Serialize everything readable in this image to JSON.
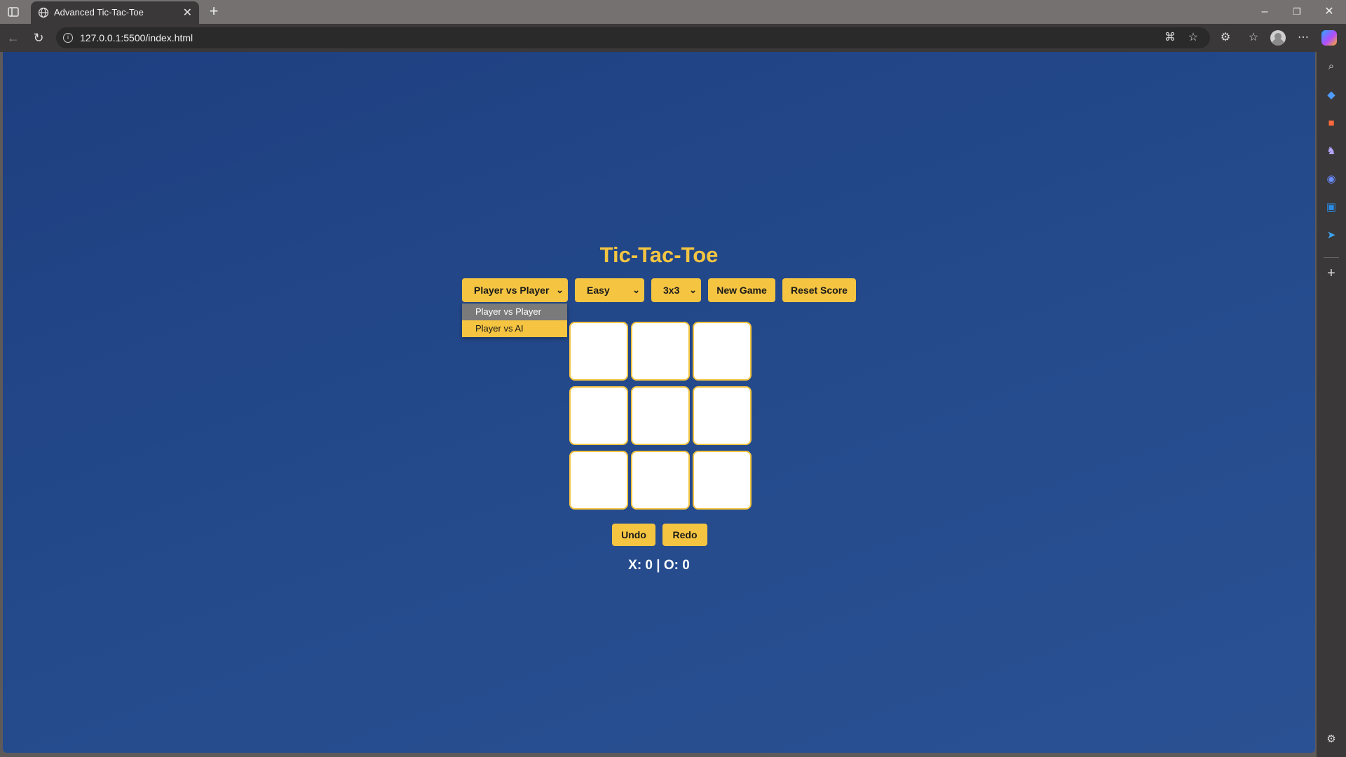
{
  "browser": {
    "tab_title": "Advanced Tic-Tac-Toe",
    "url": "127.0.0.1:5500/index.html"
  },
  "game": {
    "title": "Tic-Tac-Toe",
    "mode_select": {
      "value": "Player vs Player",
      "options": [
        "Player vs Player",
        "Player vs AI"
      ],
      "highlighted": "Player vs Player"
    },
    "difficulty_select": {
      "value": "Easy"
    },
    "size_select": {
      "value": "3x3"
    },
    "new_game_label": "New Game",
    "reset_score_label": "Reset Score",
    "undo_label": "Undo",
    "redo_label": "Redo",
    "board": {
      "rows": 3,
      "cols": 3,
      "cells": [
        "",
        "",
        "",
        "",
        "",
        "",
        "",
        "",
        ""
      ]
    },
    "score_text": "X: 0 | O: 0"
  },
  "colors": {
    "accent": "#f5c542",
    "background": "#244a8c",
    "cell": "#ffffff"
  },
  "icons": {
    "toolbar": [
      "back-icon",
      "refresh-icon",
      "read-aloud-icon",
      "favorite-star-icon",
      "extensions-icon",
      "favorites-icon",
      "profile-icon",
      "more-icon",
      "copilot-icon"
    ],
    "sidebar": [
      "search-icon",
      "shopping-tag-icon",
      "tools-icon",
      "games-icon",
      "copilot-sidebar-icon",
      "outlook-icon",
      "send-icon",
      "add-icon",
      "settings-icon"
    ]
  }
}
